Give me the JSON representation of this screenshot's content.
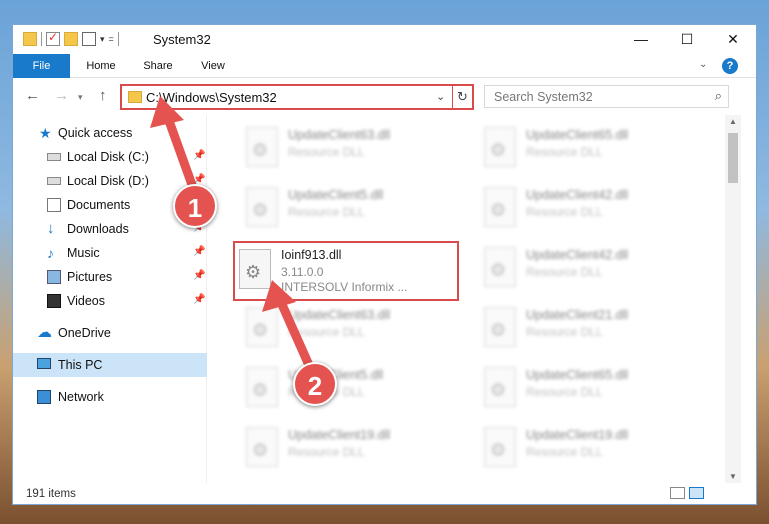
{
  "window": {
    "title": "System32",
    "controls": {
      "minimize": "—",
      "maximize": "☐",
      "close": "✕"
    }
  },
  "ribbon": {
    "tabs": [
      "File",
      "Home",
      "Share",
      "View"
    ],
    "expand_icon": "chevron-down-icon",
    "help_label": "?"
  },
  "nav": {
    "address": "C:\\Windows\\System32",
    "search_placeholder": "Search System32"
  },
  "sidebar": {
    "items": [
      {
        "label": "Quick access",
        "icon": "star-icon",
        "pinned": false
      },
      {
        "label": "Local Disk (C:)",
        "icon": "disk-icon",
        "pinned": true
      },
      {
        "label": "Local Disk (D:)",
        "icon": "disk-icon",
        "pinned": true
      },
      {
        "label": "Documents",
        "icon": "documents-icon",
        "pinned": true
      },
      {
        "label": "Downloads",
        "icon": "downloads-icon",
        "pinned": true
      },
      {
        "label": "Music",
        "icon": "music-icon",
        "pinned": true
      },
      {
        "label": "Pictures",
        "icon": "pictures-icon",
        "pinned": true
      },
      {
        "label": "Videos",
        "icon": "videos-icon",
        "pinned": true
      },
      {
        "label": "OneDrive",
        "icon": "onedrive-icon",
        "pinned": false
      },
      {
        "label": "This PC",
        "icon": "pc-icon",
        "selected": true
      },
      {
        "label": "Network",
        "icon": "network-icon",
        "pinned": false
      }
    ]
  },
  "files": {
    "left": [
      {
        "name": "UpdateClient63.dll",
        "type": "Resource DLL"
      },
      {
        "name": "UpdateClient5.dll",
        "type": "Resource DLL"
      },
      {
        "name": "Ioinf913.dll",
        "version": "3.11.0.0",
        "company": "INTERSOLV Informix ...",
        "highlighted": true
      },
      {
        "name": "UpdateClient63.dll",
        "type": "Resource DLL"
      },
      {
        "name": "UpdateClient5.dll",
        "type": "Resource DLL"
      },
      {
        "name": "UpdateClient19.dll",
        "type": "Resource DLL"
      }
    ],
    "right": [
      {
        "name": "UpdateClient65.dll",
        "type": "Resource DLL"
      },
      {
        "name": "UpdateClient42.dll",
        "type": "Resource DLL"
      },
      {
        "name": "UpdateClient42.dll",
        "type": "Resource DLL"
      },
      {
        "name": "UpdateClient21.dll",
        "type": "Resource DLL"
      },
      {
        "name": "UpdateClient65.dll",
        "type": "Resource DLL"
      },
      {
        "name": "UpdateClient19.dll",
        "type": "Resource DLL"
      }
    ]
  },
  "status": {
    "count": "191 items"
  },
  "annotations": {
    "step1": "1",
    "step2": "2",
    "color": "#e4534f"
  }
}
